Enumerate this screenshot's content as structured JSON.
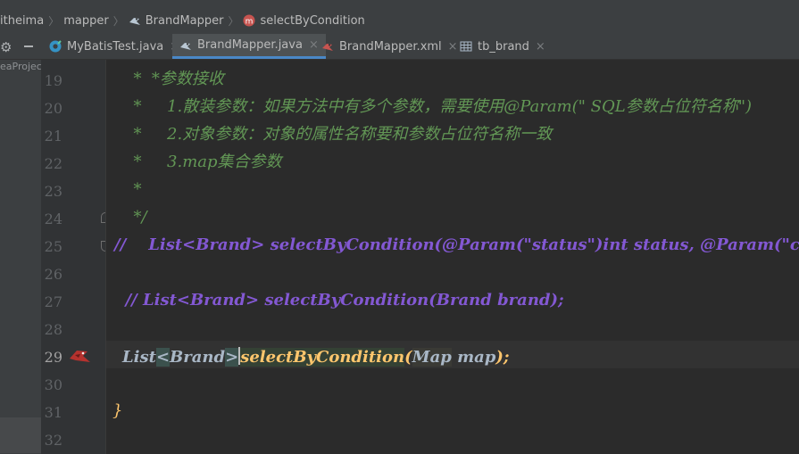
{
  "breadcrumb": {
    "items": [
      "itheima",
      "mapper",
      "BrandMapper",
      "selectByCondition"
    ]
  },
  "tabs": [
    {
      "label": "MyBatisTest.java",
      "icon": "java-class-icon",
      "active": false
    },
    {
      "label": "BrandMapper.java",
      "icon": "interface-icon",
      "active": true
    },
    {
      "label": "BrandMapper.xml",
      "icon": "mybatis-xml-icon",
      "active": false
    },
    {
      "label": "tb_brand",
      "icon": "table-icon",
      "active": false
    }
  ],
  "tab_close_glyph": "×",
  "toolwindow": {
    "project_label": "eaProjec"
  },
  "editor": {
    "line_numbers": [
      "19",
      "20",
      "21",
      "22",
      "23",
      "24",
      "25",
      "26",
      "27",
      "28",
      "29",
      "30",
      "31",
      "32"
    ],
    "current_line": "29",
    "lines": {
      "l19": "  *  *参数接收",
      "l20": "  *     1.散装参数：如果方法中有多个参数，需要使用@Param(\" SQL参数占位符名称\")",
      "l21": "  *     2.对象参数：对象的属性名称要和参数占位符名称一致",
      "l22": "  *     3.map集合参数",
      "l23": "  *",
      "l24": "  */",
      "l25": "//    List<Brand> selectByCondition(@Param(\"status\")int status, @Param(\"company",
      "l27": "  // List<Brand> selectByCondition(Brand brand);",
      "l29_type": "List",
      "l29_generic_open": "<",
      "l29_generic_name": "Brand",
      "l29_generic_close": ">",
      "l29_method": "selectByCondition",
      "l29_paren_open": "(",
      "l29_param_type": "Map",
      "l29_param_name": " map",
      "l29_end": ");",
      "l31": "}"
    }
  },
  "colors": {
    "comment": "#629755",
    "commented_code": "#8358d3",
    "method": "#ffc66d",
    "identifier": "#a9b7c6",
    "accent": "#4a88c7"
  }
}
